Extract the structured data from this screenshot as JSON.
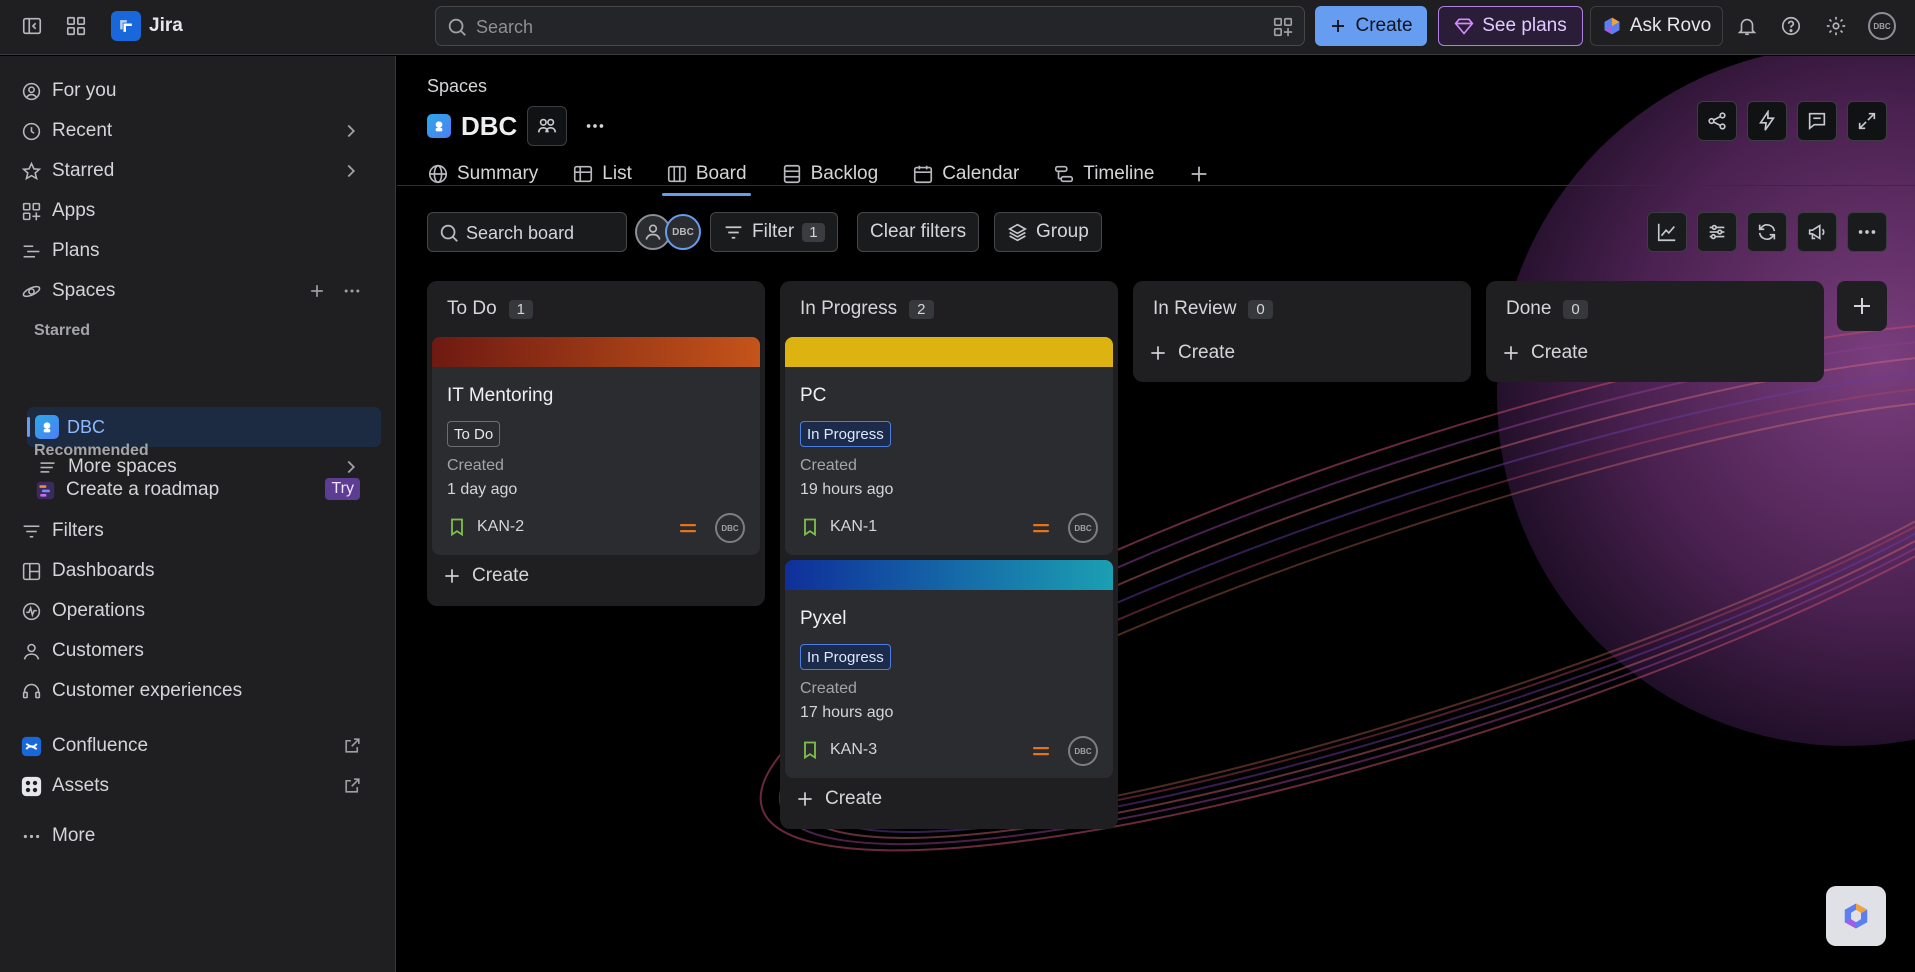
{
  "topbar": {
    "app_name": "Jira",
    "search_placeholder": "Search",
    "create_label": "Create",
    "see_plans_label": "See plans",
    "ask_rovo_label": "Ask Rovo",
    "avatar_text": "DBC"
  },
  "sidebar": {
    "items": [
      {
        "label": "For you",
        "icon": "user-circle-icon"
      },
      {
        "label": "Recent",
        "icon": "clock-icon"
      },
      {
        "label": "Starred",
        "icon": "star-icon"
      },
      {
        "label": "Apps",
        "icon": "apps-icon"
      },
      {
        "label": "Plans",
        "icon": "plans-icon"
      },
      {
        "label": "Spaces",
        "icon": "spaces-icon"
      }
    ],
    "starred_heading": "Starred",
    "starred_space": "DBC",
    "more_spaces": "More spaces",
    "recommended_heading": "Recommended",
    "roadmap_label": "Create a roadmap",
    "try_badge": "Try",
    "bottom_items": [
      {
        "label": "Filters",
        "icon": "filter-icon"
      },
      {
        "label": "Dashboards",
        "icon": "dashboard-icon"
      },
      {
        "label": "Operations",
        "icon": "operations-icon"
      },
      {
        "label": "Customers",
        "icon": "customers-icon"
      },
      {
        "label": "Customer experiences",
        "icon": "headset-icon"
      }
    ],
    "apps": [
      {
        "label": "Confluence",
        "icon": "confluence-icon"
      },
      {
        "label": "Assets",
        "icon": "assets-icon"
      }
    ],
    "more_label": "More"
  },
  "header": {
    "breadcrumb": "Spaces",
    "project_name": "DBC"
  },
  "tabs": [
    {
      "label": "Summary",
      "icon": "globe-icon"
    },
    {
      "label": "List",
      "icon": "list-icon"
    },
    {
      "label": "Board",
      "icon": "board-icon",
      "active": true
    },
    {
      "label": "Backlog",
      "icon": "backlog-icon"
    },
    {
      "label": "Calendar",
      "icon": "calendar-icon"
    },
    {
      "label": "Timeline",
      "icon": "timeline-icon"
    }
  ],
  "toolbar": {
    "search_board": "Search board",
    "filter_label": "Filter",
    "filter_count": "1",
    "clear_filters": "Clear filters",
    "group_label": "Group",
    "avatar_text": "DBC"
  },
  "columns": [
    {
      "name": "To Do",
      "count": "1",
      "create": "Create"
    },
    {
      "name": "In Progress",
      "count": "2",
      "create": "Create"
    },
    {
      "name": "In Review",
      "count": "0",
      "create": "Create"
    },
    {
      "name": "Done",
      "count": "0",
      "create": "Create"
    }
  ],
  "cards": [
    {
      "title": "IT Mentoring",
      "status": "To Do",
      "created_label": "Created",
      "created": "1 day ago",
      "key": "KAN-2",
      "assignee": "DBC"
    },
    {
      "title": "PC",
      "status": "In Progress",
      "created_label": "Created",
      "created": "19 hours ago",
      "key": "KAN-1",
      "assignee": "DBC"
    },
    {
      "title": "Pyxel",
      "status": "In Progress",
      "created_label": "Created",
      "created": "17 hours ago",
      "key": "KAN-3",
      "assignee": "DBC"
    }
  ],
  "colors": {
    "accent": "#669df1",
    "priority_medium": "#e2731f",
    "story": "#7dbf4b"
  }
}
